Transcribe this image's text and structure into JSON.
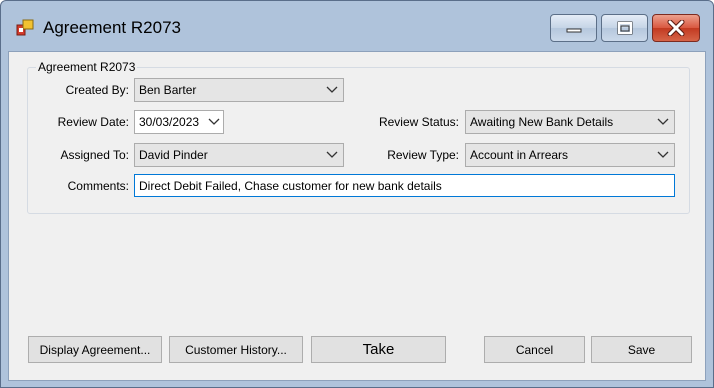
{
  "window": {
    "title": "Agreement R2073"
  },
  "group": {
    "label": "Agreement R2073"
  },
  "form": {
    "created_by": {
      "label": "Created By:",
      "value": "Ben Barter"
    },
    "review_date": {
      "label": "Review Date:",
      "value": "30/03/2023"
    },
    "assigned_to": {
      "label": "Assigned To:",
      "value": "David Pinder"
    },
    "comments": {
      "label": "Comments:",
      "value": "Direct Debit Failed, Chase customer for new bank details"
    },
    "review_status": {
      "label": "Review Status:",
      "value": "Awaiting New Bank Details"
    },
    "review_type": {
      "label": "Review Type:",
      "value": "Account in Arrears"
    }
  },
  "buttons": {
    "display_agreement": "Display Agreement...",
    "customer_history": "Customer History...",
    "take": "Take",
    "cancel": "Cancel",
    "save": "Save"
  },
  "icons": {
    "app": "app-icon",
    "minimize": "minimize-icon",
    "maximize": "maximize-icon",
    "close": "close-icon",
    "dropdown": "chevron-down-icon"
  },
  "colors": {
    "title_frame": "#afc3db",
    "close_button": "#c94a32",
    "focus_border": "#0078d7",
    "client_background": "#f0f0f0"
  }
}
